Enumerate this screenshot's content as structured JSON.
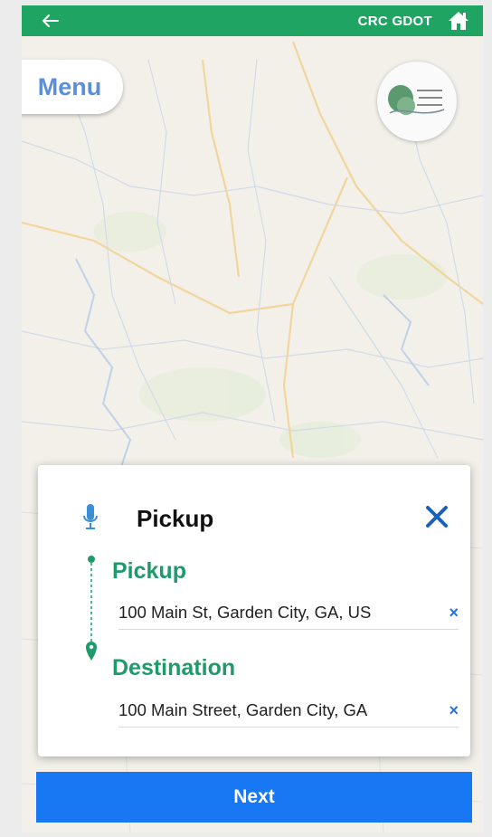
{
  "header": {
    "title": "CRC GDOT",
    "back_icon": "arrow-left-icon",
    "home_icon": "home-icon",
    "color": "#1fa463"
  },
  "menu": {
    "label": "Menu"
  },
  "trip_card": {
    "title": "Pickup",
    "pickup": {
      "label": "Pickup",
      "value": "100 Main St, Garden City, GA, US"
    },
    "destination": {
      "label": "Destination",
      "value": "100 Main Street, Garden City, GA"
    },
    "label_color": "#1f9a6b"
  },
  "actions": {
    "next_label": "Next",
    "next_color": "#1877f2"
  }
}
